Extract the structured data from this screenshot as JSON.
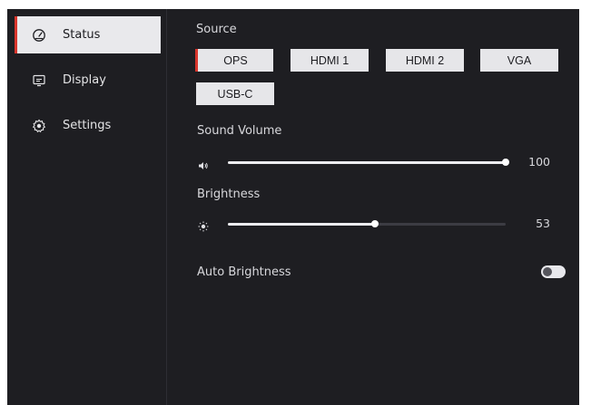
{
  "sidebar": {
    "items": [
      {
        "label": "Status",
        "icon": "gauge-icon",
        "active": true
      },
      {
        "label": "Display",
        "icon": "monitor-icon",
        "active": false
      },
      {
        "label": "Settings",
        "icon": "gear-icon",
        "active": false
      }
    ]
  },
  "source": {
    "title": "Source",
    "options": [
      "OPS",
      "HDMI 1",
      "HDMI 2",
      "VGA",
      "USB-C"
    ],
    "selected": "OPS"
  },
  "sound_volume": {
    "label": "Sound Volume",
    "icon": "speaker-icon",
    "value": "100",
    "fraction": 1.0
  },
  "brightness": {
    "label": "Brightness",
    "icon": "sun-icon",
    "value": "53",
    "fraction": 0.53
  },
  "auto_brightness": {
    "label": "Auto Brightness",
    "enabled": false
  },
  "colors": {
    "background": "#1e1e22",
    "accent": "#d9352c",
    "button": "#e6e6e9"
  }
}
